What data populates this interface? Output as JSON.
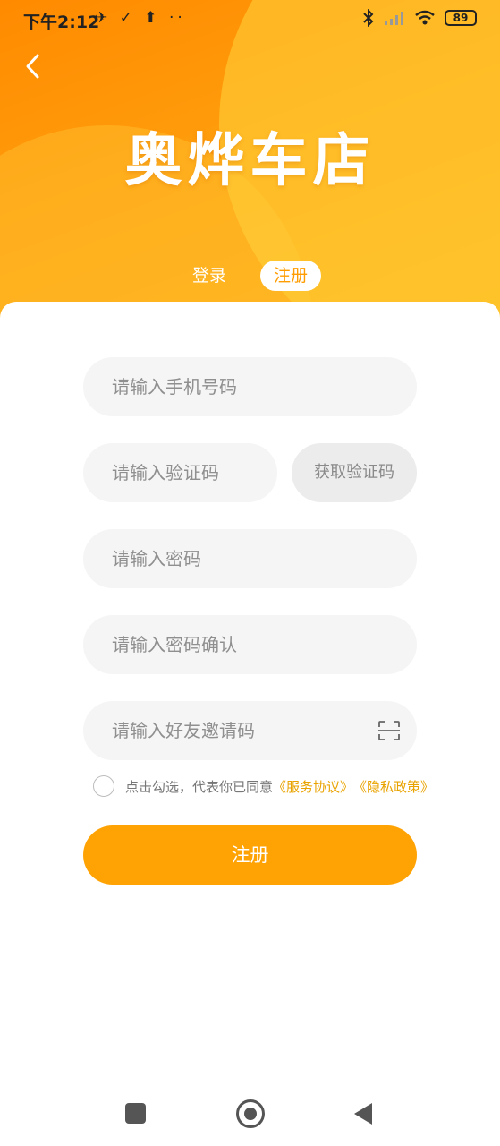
{
  "status_bar": {
    "time": "下午2:12",
    "left_icons": "✈ ✓ ⬆ ··",
    "battery": "89"
  },
  "header": {
    "logo_text": "奥烨车店",
    "tabs": {
      "login": "登录",
      "register": "注册"
    }
  },
  "form": {
    "phone_placeholder": "请输入手机号码",
    "code_placeholder": "请输入验证码",
    "get_code_label": "获取验证码",
    "password_placeholder": "请输入密码",
    "password_confirm_placeholder": "请输入密码确认",
    "invite_placeholder": "请输入好友邀请码",
    "agreement": {
      "prefix": "点击勾选，代表你已同意",
      "service_link": "《服务协议》",
      "privacy_link": "《隐私政策》"
    },
    "submit_label": "注册"
  },
  "colors": {
    "accent": "#ffa305",
    "link": "#e9a300",
    "field_bg": "#f5f5f5"
  },
  "icons": [
    "back-chevron-icon",
    "bluetooth-icon",
    "signal-icon",
    "wifi-icon",
    "battery-icon",
    "scan-icon",
    "nav-square-icon",
    "nav-home-icon",
    "nav-back-icon"
  ]
}
